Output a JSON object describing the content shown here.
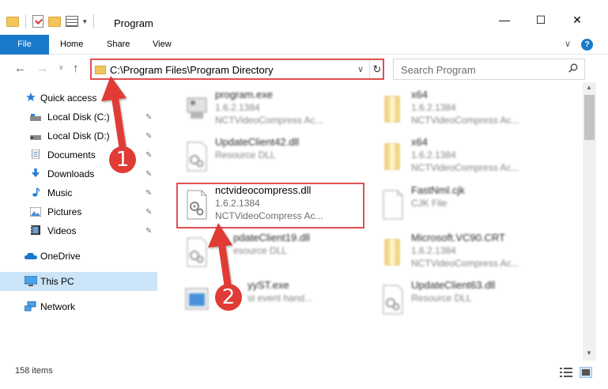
{
  "window": {
    "title": "Program",
    "minimize": "—",
    "maximize": "☐",
    "close": "✕"
  },
  "ribbon": {
    "tabs": [
      "File",
      "Home",
      "Share",
      "View"
    ],
    "chevron": "∨",
    "help": "?"
  },
  "nav": {
    "back": "←",
    "forward": "→",
    "up": "↑",
    "recent_dropdown": "∨",
    "address": "C:\\Program Files\\Program Directory",
    "address_chevron": "∨",
    "refresh": "↻",
    "search_placeholder": "Search Program"
  },
  "sidebar": {
    "items": [
      {
        "label": "Quick access",
        "icon": "star-icon",
        "pinned": false
      },
      {
        "label": "Local Disk (C:)",
        "icon": "drive-icon",
        "pinned": true
      },
      {
        "label": "Local Disk (D:)",
        "icon": "drive-icon",
        "pinned": true
      },
      {
        "label": "Documents",
        "icon": "documents-icon",
        "pinned": true
      },
      {
        "label": "Downloads",
        "icon": "download-icon",
        "pinned": true
      },
      {
        "label": "Music",
        "icon": "music-icon",
        "pinned": true
      },
      {
        "label": "Pictures",
        "icon": "pictures-icon",
        "pinned": true
      },
      {
        "label": "Videos",
        "icon": "videos-icon",
        "pinned": true
      },
      {
        "label": "OneDrive",
        "icon": "cloud-icon",
        "pinned": false
      },
      {
        "label": "This PC",
        "icon": "computer-icon",
        "pinned": false
      },
      {
        "label": "Network",
        "icon": "network-icon",
        "pinned": false
      }
    ],
    "pin_glyph": "📌"
  },
  "files": [
    {
      "name": "program.exe",
      "line1": "1.6.2.1384",
      "line2": "NCTVideoCompress Ac..."
    },
    {
      "name": "x64",
      "line1": "1.6.2.1384",
      "line2": "NCTVideoCompress Ac..."
    },
    {
      "name": "UpdateClient42.dll",
      "line1": "Resource DLL",
      "line2": ""
    },
    {
      "name": "x64",
      "line1": "1.6.2.1384",
      "line2": "NCTVideoCompress Ac..."
    },
    {
      "name": "nctvideocompress.dll",
      "line1": "1.6.2.1384",
      "line2": "NCTVideoCompress Ac..."
    },
    {
      "name": "FastNml.cjk",
      "line1": "CJK File",
      "line2": ""
    },
    {
      "name": "pdateClient19.dll",
      "line1": "esource DLL",
      "line2": ""
    },
    {
      "name": "Microsoft.VC90.CRT",
      "line1": "1.6.2.1384",
      "line2": "NCTVideoCompress Ac..."
    },
    {
      "name": "yyST.exe",
      "line1": "st event hand...",
      "line2": ""
    },
    {
      "name": "UpdateClient63.dll",
      "line1": "Resource DLL",
      "line2": ""
    }
  ],
  "status": {
    "item_count": "158 items"
  },
  "callouts": [
    "1",
    "2"
  ],
  "colors": {
    "accent": "#1979ca",
    "highlight_border": "#e05050",
    "callout": "#e03b36",
    "selected_bg": "#cce4f7"
  }
}
